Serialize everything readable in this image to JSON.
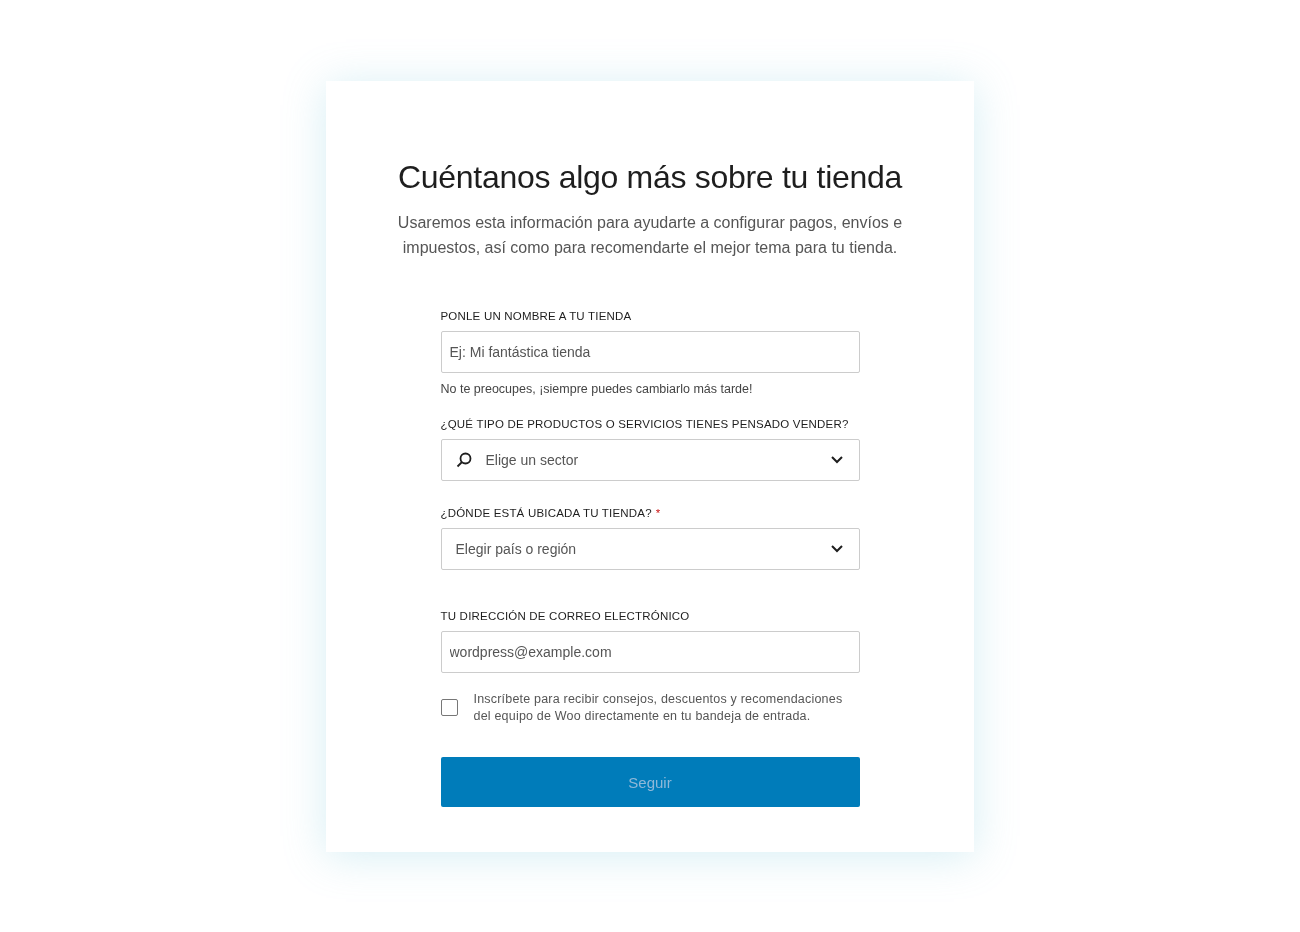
{
  "heading": "Cuéntanos algo más sobre tu tienda",
  "subtitle": "Usaremos esta información para ayudarte a configurar pagos, envíos e impuestos, así como para recomendarte el mejor tema para tu tienda.",
  "fields": [
    {
      "kind": "text",
      "label": "PONLE UN NOMBRE A TU TIENDA",
      "placeholder": "Ej: Mi fantástica tienda",
      "help": "No te preocupes, ¡siempre puedes cambiarlo más tarde!"
    },
    {
      "kind": "search-select",
      "label": "¿QUÉ TIPO DE PRODUCTOS O SERVICIOS TIENES PENSADO VENDER?",
      "placeholder": "Elige un sector"
    },
    {
      "kind": "select",
      "label": "¿DÓNDE ESTÁ UBICADA TU TIENDA?",
      "required_mark": "*",
      "placeholder": "Elegir país o región"
    },
    {
      "kind": "text",
      "label": "TU DIRECCIÓN DE CORREO ELECTRÓNICO",
      "placeholder": "wordpress@example.com"
    }
  ],
  "newsletter": {
    "label": "Inscríbete para recibir consejos, descuentos y recomendaciones del equipo de Woo directamente en tu bandeja de entrada.",
    "checked": false
  },
  "submit": {
    "label": "Seguir",
    "disabled": true
  }
}
